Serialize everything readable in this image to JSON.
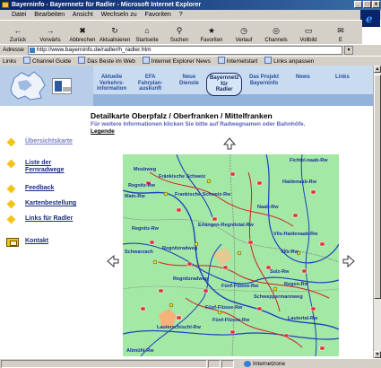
{
  "window": {
    "title": "Bayerninfo - Bayernnetz für Radler - Microsoft Internet Explorer",
    "controls": [
      "_",
      "□",
      "x"
    ]
  },
  "menu": [
    "Datei",
    "Bearbeiten",
    "Ansicht",
    "Wechseln zu",
    "Favoriten",
    "?"
  ],
  "toolbar": [
    {
      "label": "Zurück",
      "icon": "back-arrow-icon",
      "glyph": "←"
    },
    {
      "label": "Vorwärts",
      "icon": "forward-arrow-icon",
      "glyph": "→"
    },
    {
      "label": "Abbrechen",
      "icon": "stop-icon",
      "glyph": "✖"
    },
    {
      "label": "Aktualisieren",
      "icon": "refresh-icon",
      "glyph": "↻"
    },
    {
      "label": "Startseite",
      "icon": "home-icon",
      "glyph": "⌂"
    },
    {
      "label": "Suchen",
      "icon": "search-icon",
      "glyph": "⚲"
    },
    {
      "label": "Favoriten",
      "icon": "favorites-icon",
      "glyph": "★"
    },
    {
      "label": "Verlauf",
      "icon": "history-icon",
      "glyph": "◷"
    },
    {
      "label": "Channels",
      "icon": "channels-icon",
      "glyph": "◎"
    },
    {
      "label": "Vollbild",
      "icon": "fullscreen-icon",
      "glyph": "▭"
    },
    {
      "label": "E",
      "icon": "mail-icon",
      "glyph": "✉"
    }
  ],
  "address": {
    "label": "Adresse",
    "value": "http://www.bayerninfo.de/radler/h_radler.htm"
  },
  "links": {
    "label": "Links",
    "items": [
      "Channel Guide",
      "Das Beste im Web",
      "Internet Explorer News",
      "Internetstart",
      "Links anpassen"
    ]
  },
  "nav_top": [
    {
      "label": "Aktuelle Verkehrs-information",
      "lines": [
        "Aktuelle",
        "Verkehrs-",
        "information"
      ]
    },
    {
      "label": "EFA Fahrplan-auskunft",
      "lines": [
        "EFA",
        "Fahrplan-",
        "auskunft"
      ]
    },
    {
      "label": "Neue Dienste",
      "lines": [
        "Neue",
        "Dienste"
      ]
    },
    {
      "label": "Bayernnetz für Radler",
      "lines": [
        "Bayernnetz",
        "für",
        "Radler"
      ],
      "active": true
    },
    {
      "label": "Das Projekt Bayerninfo",
      "lines": [
        "Das Projekt",
        "Bayerninfo"
      ]
    },
    {
      "label": "News",
      "lines": [
        "News"
      ]
    },
    {
      "label": "Links",
      "lines": [
        "Links"
      ]
    }
  ],
  "nav_left": [
    {
      "label": "Übersichtskarte",
      "dim": true
    },
    {
      "label": "Liste der Fernradwege",
      "lines": [
        "Liste der",
        "Fernradwege"
      ]
    },
    {
      "label": "Feedback"
    },
    {
      "label": "Kartenbestellung"
    },
    {
      "label": "Links für Radler"
    },
    {
      "label": "Kontakt",
      "icon": "contact-icon"
    }
  ],
  "content": {
    "title": "Detailkarte Oberpfalz / Oberfranken / Mittelfranken",
    "subtitle": "Für weitere Informationen klicken Sie bitte auf Radwegnamen oder Bahnhöfe.",
    "legend_link": "Legende"
  },
  "map": {
    "labels": [
      "Fichtel-naab-Rw",
      "Mosbweg",
      "Fränkische Schweiz",
      "Regnitz-Rw",
      "Haidenaab-Rw",
      "Main-Rw",
      "Frankische Schweiz-Rw",
      "Naab-Rw",
      "Erlangen-Regnitztal-Rw",
      "Vils-Haidenaab-Rw",
      "Regnitz-Rw",
      "Schwarzach",
      "Vils-Rw",
      "Regnitzradweg",
      "Sulz-Rw",
      "Fünf-Flüsse-Rw",
      "Regnitzradweg",
      "Regen-Rw",
      "Schweppermannweg",
      "Fünf-Flüsse-Rw",
      "Fünf-Flüsse-Rw",
      "Lautertal-Rw",
      "Lauterschischl-Rw",
      "Altmühl-Rw"
    ]
  },
  "status": {
    "text": "",
    "zone": "Internetzone"
  },
  "colors": {
    "titlebar": "#0a246a",
    "chrome": "#d4d0c8",
    "nav_text": "#2a4f9a",
    "map_land": "#9fe6a2",
    "route_blue": "#1f3fbf",
    "route_red": "#d22020",
    "bullet": "#f2c41a"
  }
}
